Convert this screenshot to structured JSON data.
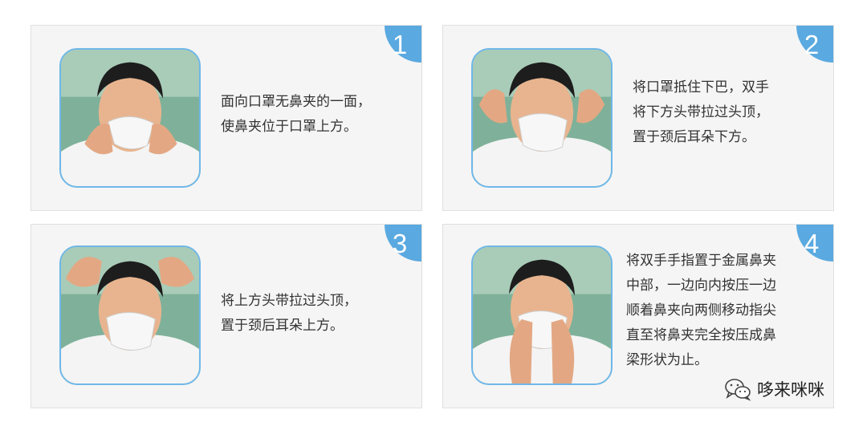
{
  "steps": [
    {
      "number": "1",
      "lines": [
        "面向口罩无鼻夹的一面，",
        "使鼻夹位于口罩上方。"
      ]
    },
    {
      "number": "2",
      "lines": [
        "将口罩抵住下巴，双手",
        "将下方头带拉过头顶，",
        "置于颈后耳朵下方。"
      ]
    },
    {
      "number": "3",
      "lines": [
        "将上方头带拉过头顶，",
        "置于颈后耳朵上方。"
      ]
    },
    {
      "number": "4",
      "lines": [
        "将双手手指置于金属鼻夹",
        "中部，一边向内按压一边",
        "顺着鼻夹向两侧移动指尖",
        "直至将鼻夹完全按压成鼻",
        "梁形状为止。"
      ]
    }
  ],
  "watermark": {
    "text": "哆来咪咪",
    "icon": "wechat-icon"
  },
  "colors": {
    "badge": "#5aa9e0",
    "photo_border": "#6fb7e8",
    "card_bg": "#f5f5f5",
    "text": "#333333"
  }
}
